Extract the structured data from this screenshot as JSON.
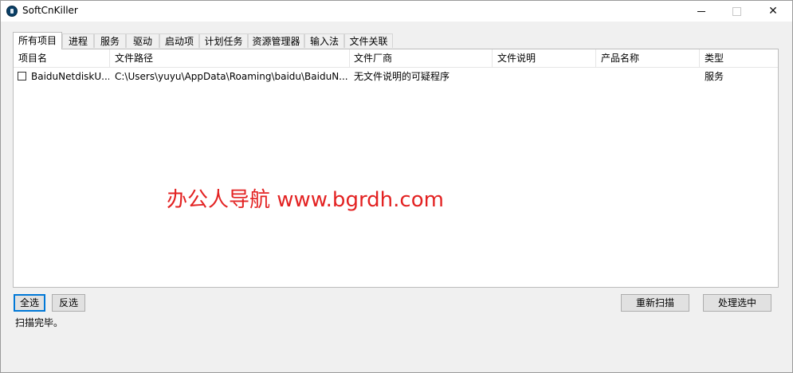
{
  "window": {
    "title": "SoftCnKiller",
    "icon": "app-icon"
  },
  "tabs": [
    {
      "label": "所有项目",
      "active": true
    },
    {
      "label": "进程",
      "active": false
    },
    {
      "label": "服务",
      "active": false
    },
    {
      "label": "驱动",
      "active": false
    },
    {
      "label": "启动项",
      "active": false
    },
    {
      "label": "计划任务",
      "active": false
    },
    {
      "label": "资源管理器",
      "active": false
    },
    {
      "label": "输入法",
      "active": false
    },
    {
      "label": "文件关联",
      "active": false
    }
  ],
  "table": {
    "columns": [
      "项目名",
      "文件路径",
      "文件厂商",
      "文件说明",
      "产品名称",
      "类型"
    ],
    "rows": [
      {
        "checked": false,
        "name": "BaiduNetdiskU...",
        "path": "C:\\Users\\yuyu\\AppData\\Roaming\\baidu\\BaiduN...",
        "vendor": "无文件说明的可疑程序",
        "description": "",
        "product": "",
        "type": "服务"
      }
    ]
  },
  "watermark": "办公人导航 www.bgrdh.com",
  "buttons": {
    "select_all": "全选",
    "invert": "反选",
    "rescan": "重新扫描",
    "process": "处理选中"
  },
  "status": "扫描完毕。",
  "colors": {
    "focus_border": "#0078d7",
    "watermark": "#e32222",
    "icon_bg": "#0a3f66"
  }
}
